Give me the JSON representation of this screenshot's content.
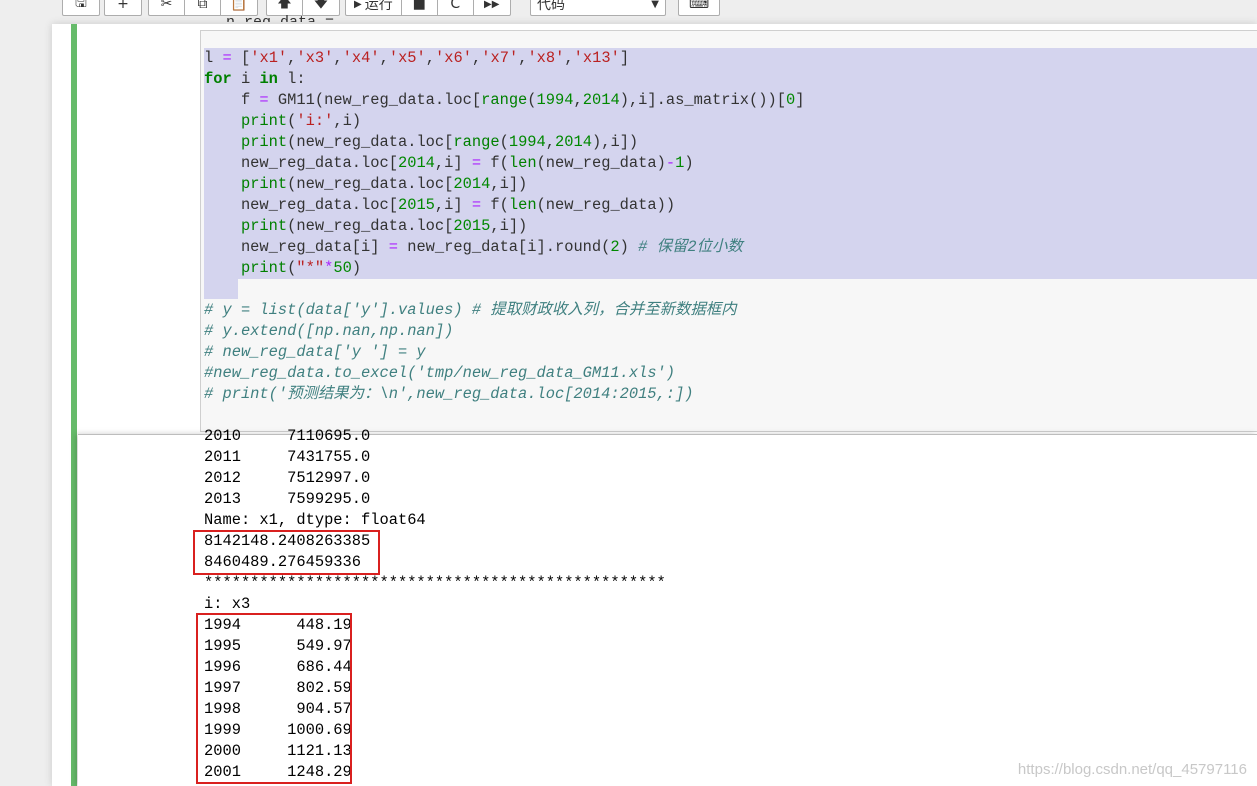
{
  "toolbar": {
    "buttons": [
      {
        "icon": "save-icon",
        "glyph": "🖫"
      },
      {
        "icon": "plus-icon",
        "glyph": "+"
      },
      {
        "icon": "cut-icon",
        "glyph": "✂"
      },
      {
        "icon": "copy-icon",
        "glyph": "⧉"
      },
      {
        "icon": "paste-icon",
        "glyph": "📋"
      },
      {
        "icon": "arrow-up-icon",
        "glyph": "🡅"
      },
      {
        "icon": "arrow-down-icon",
        "glyph": "🡇"
      },
      {
        "icon": "run-icon",
        "glyph": "▶|"
      },
      {
        "icon": "stop-icon",
        "glyph": "■"
      },
      {
        "icon": "restart-icon",
        "glyph": "C"
      },
      {
        "icon": "fast-forward-icon",
        "glyph": "▶▶"
      },
      {
        "icon": "keyboard-icon",
        "glyph": "⌨"
      }
    ],
    "run_label": "运行",
    "cell_type_select": "代码"
  },
  "code_lines": [
    "l = ['x1','x3','x4','x5','x6','x7','x8','x13']",
    "for i in l:",
    "    f = GM11(new_reg_data.loc[range(1994,2014),i].as_matrix())[0]",
    "    print('i:',i)",
    "    print(new_reg_data.loc[range(1994,2014),i])",
    "    new_reg_data.loc[2014,i] = f(len(new_reg_data)-1)",
    "    print(new_reg_data.loc[2014,i])",
    "    new_reg_data.loc[2015,i] = f(len(new_reg_data))",
    "    print(new_reg_data.loc[2015,i])",
    "    new_reg_data[i] = new_reg_data[i].round(2) # 保留2位小数",
    "    print(\"*\"*50)",
    "",
    "# y = list(data['y'].values) # 提取财政收入列，合并至新数据框内",
    "# y.extend([np.nan,np.nan])",
    "# new_reg_data['y '] = y",
    "#new_reg_data.to_excel('tmp/new_reg_data_GM11.xls')",
    "# print('预测结果为：\\n',new_reg_data.loc[2014:2015,:])"
  ],
  "output_lines": [
    "2010     7110695.0",
    "2011     7431755.0",
    "2012     7512997.0",
    "2013     7599295.0",
    "Name: x1, dtype: float64",
    "8142148.2408263385",
    "8460489.276459336",
    "**************************************************",
    "i: x3",
    "1994      448.19",
    "1995      549.97",
    "1996      686.44",
    "1997      802.59",
    "1998      904.57",
    "1999     1000.69",
    "2000     1121.13",
    "2001     1248.29"
  ],
  "watermark": "https://blog.csdn.net/qq_45797116",
  "colors": {
    "cell_bar": "#66bb6a",
    "selection": "#d4d4ee",
    "highlight_box": "#d9201f"
  }
}
